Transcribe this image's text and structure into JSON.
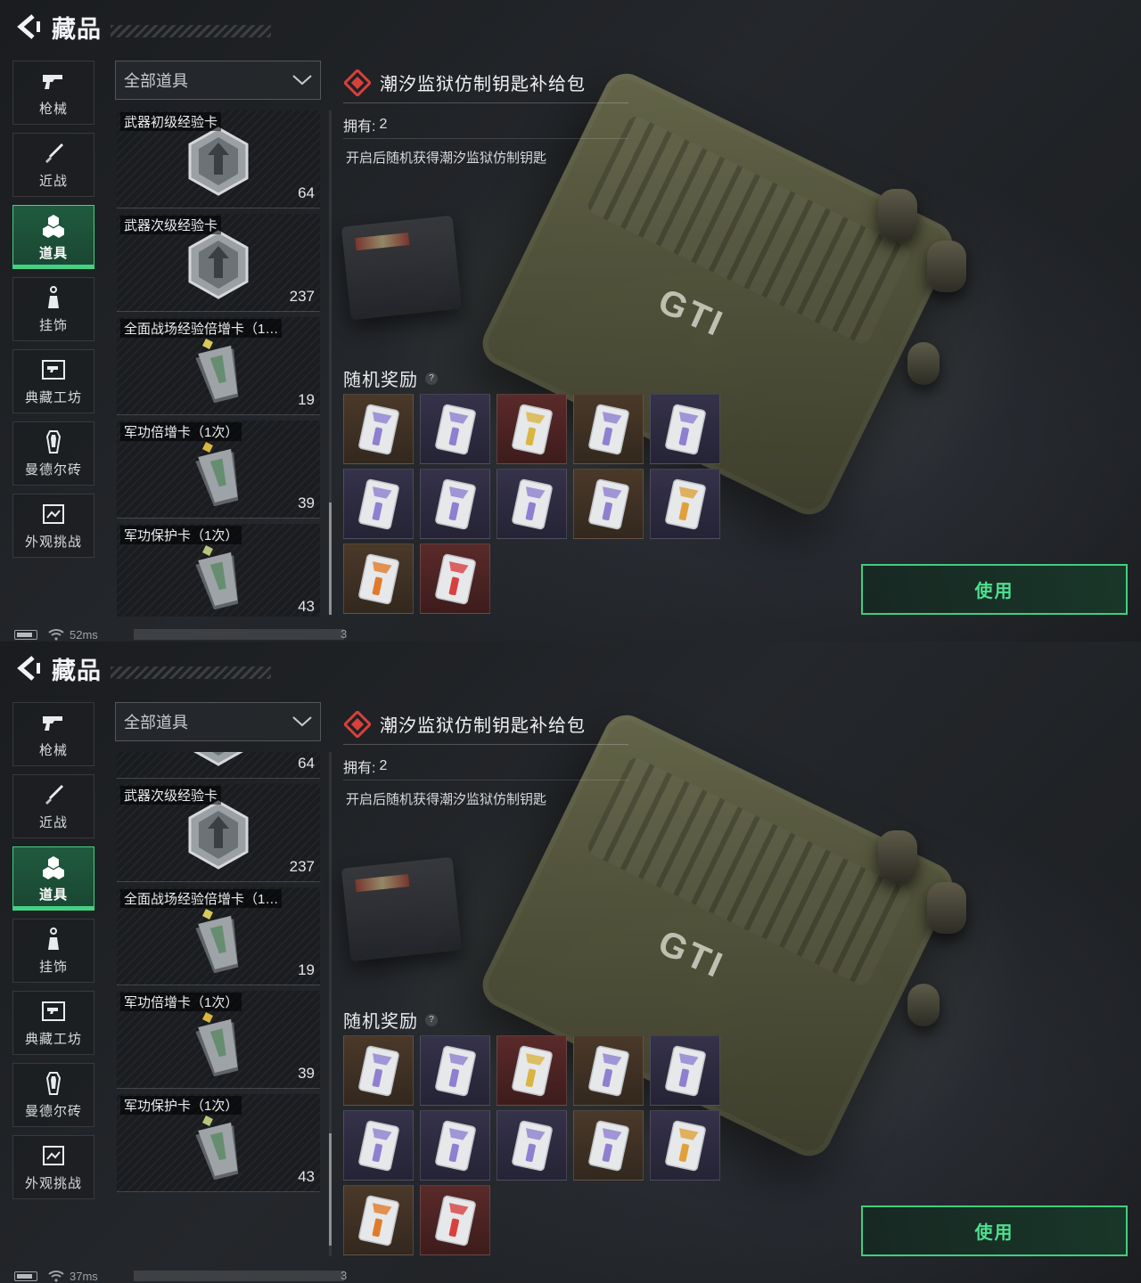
{
  "header": {
    "title": "藏品"
  },
  "sidebar": [
    {
      "label": "枪械",
      "icon": "gun-icon"
    },
    {
      "label": "近战",
      "icon": "knife-icon"
    },
    {
      "label": "道具",
      "icon": "items-icon",
      "active": true
    },
    {
      "label": "挂饰",
      "icon": "charm-icon"
    },
    {
      "label": "典藏工坊",
      "icon": "workshop-icon"
    },
    {
      "label": "曼德尔砖",
      "icon": "brick-icon"
    },
    {
      "label": "外观挑战",
      "icon": "challenge-icon"
    }
  ],
  "filter": {
    "label": "全部道具"
  },
  "items": [
    {
      "name": "武器初级经验卡",
      "count": "64",
      "icon": "weapon-exp-card-icon"
    },
    {
      "name": "武器次级经验卡",
      "count": "237",
      "icon": "weapon-exp-card-icon"
    },
    {
      "name": "全面战场经验倍增卡（1…",
      "count": "19",
      "icon": "exp-boost-card-icon"
    },
    {
      "name": "军功倍增卡（1次）",
      "count": "39",
      "icon": "merit-boost-card-icon"
    },
    {
      "name": "军功保护卡（1次）",
      "count": "43",
      "icon": "merit-protect-card-icon"
    }
  ],
  "detail": {
    "title": "潮汐监狱仿制钥匙补给包",
    "owned_label": "拥有:",
    "owned_value": "2",
    "description": "开启后随机获得潮汐监狱仿制钥匙",
    "reward_heading": "随机奖励",
    "help": "?",
    "rewards": [
      {
        "color": "brown",
        "accent": "#8f7fd0"
      },
      {
        "color": "purple",
        "accent": "#8f7fd0"
      },
      {
        "color": "red",
        "accent": "#d9b441"
      },
      {
        "color": "brown",
        "accent": "#8f7fd0"
      },
      {
        "color": "purple",
        "accent": "#8f7fd0"
      },
      {
        "color": "purple",
        "accent": "#8f7fd0"
      },
      {
        "color": "purple",
        "accent": "#8f7fd0"
      },
      {
        "color": "purple",
        "accent": "#8f7fd0"
      },
      {
        "color": "brown",
        "accent": "#8f7fd0"
      },
      {
        "color": "purple",
        "accent": "#e0a13a"
      },
      {
        "color": "brown",
        "accent": "#e07a2a"
      },
      {
        "color": "red",
        "accent": "#d84040"
      }
    ]
  },
  "use_button": {
    "label": "使用"
  },
  "scene": {
    "case_logo": "GTI"
  },
  "panels": [
    {
      "ping": "52ms",
      "status_tail": "3",
      "list_scroll": 0
    },
    {
      "ping": "37ms",
      "status_tail": "3",
      "list_scroll": 80
    }
  ],
  "colors": {
    "accent_green": "#44d184",
    "rarity_red": "#d8403a"
  }
}
